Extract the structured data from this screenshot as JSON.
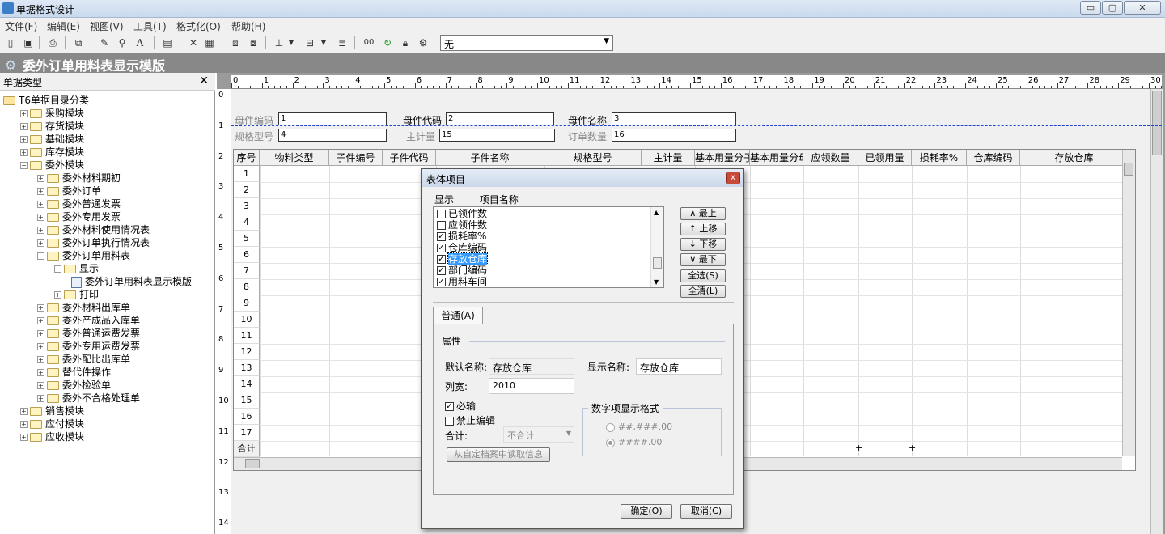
{
  "app": {
    "title": "单据格式设计",
    "win_min": "▭",
    "win_max": "▢",
    "win_close": "✕"
  },
  "menu": [
    "文件(F)",
    "编辑(E)",
    "视图(V)",
    "工具(T)",
    "格式化(O)",
    "帮助(H)"
  ],
  "toolbar": {
    "combo_value": "无",
    "text_btn": "A",
    "seq_btn": "00"
  },
  "document_title": "委外订单用料表显示模版",
  "left_panel": {
    "title": "单据类型",
    "close": "✕",
    "tree": [
      {
        "label": "T6单据目录分类",
        "level": 0,
        "pm": "",
        "root": true
      },
      {
        "label": "采购模块",
        "level": 1,
        "pm": "+"
      },
      {
        "label": "存货模块",
        "level": 1,
        "pm": "+"
      },
      {
        "label": "基础模块",
        "level": 1,
        "pm": "+"
      },
      {
        "label": "库存模块",
        "level": 1,
        "pm": "+"
      },
      {
        "label": "委外模块",
        "level": 1,
        "pm": "−"
      },
      {
        "label": "委外材料期初",
        "level": 2,
        "pm": "+"
      },
      {
        "label": "委外订单",
        "level": 2,
        "pm": "+"
      },
      {
        "label": "委外普通发票",
        "level": 2,
        "pm": "+"
      },
      {
        "label": "委外专用发票",
        "level": 2,
        "pm": "+"
      },
      {
        "label": "委外材料使用情况表",
        "level": 2,
        "pm": "+"
      },
      {
        "label": "委外订单执行情况表",
        "level": 2,
        "pm": "+"
      },
      {
        "label": "委外订单用料表",
        "level": 2,
        "pm": "−"
      },
      {
        "label": "显示",
        "level": 3,
        "pm": "−"
      },
      {
        "label": "委外订单用料表显示模版",
        "level": 4,
        "pm": "",
        "doc": true
      },
      {
        "label": "打印",
        "level": 3,
        "pm": "+"
      },
      {
        "label": "委外材料出库单",
        "level": 2,
        "pm": "+"
      },
      {
        "label": "委外产成品入库单",
        "level": 2,
        "pm": "+"
      },
      {
        "label": "委外普通运费发票",
        "level": 2,
        "pm": "+"
      },
      {
        "label": "委外专用运费发票",
        "level": 2,
        "pm": "+"
      },
      {
        "label": "委外配比出库单",
        "level": 2,
        "pm": "+"
      },
      {
        "label": "替代件操作",
        "level": 2,
        "pm": "+"
      },
      {
        "label": "委外检验单",
        "level": 2,
        "pm": "+"
      },
      {
        "label": "委外不合格处理单",
        "level": 2,
        "pm": "+"
      },
      {
        "label": "销售模块",
        "level": 1,
        "pm": "+"
      },
      {
        "label": "应付模块",
        "level": 1,
        "pm": "+"
      },
      {
        "label": "应收模块",
        "level": 1,
        "pm": "+"
      }
    ]
  },
  "ruler": {
    "h_ticks": [
      "0",
      "1",
      "2",
      "3",
      "4",
      "5",
      "6",
      "7",
      "8",
      "9",
      "10",
      "11",
      "12",
      "13",
      "14",
      "15",
      "16",
      "17",
      "18",
      "19",
      "20",
      "21",
      "22",
      "23",
      "24",
      "25",
      "26",
      "27",
      "28",
      "29",
      "30"
    ],
    "v_ticks": [
      "0",
      "1",
      "2",
      "3",
      "4",
      "5",
      "6",
      "7",
      "8",
      "9",
      "10",
      "11",
      "12",
      "13",
      "14"
    ]
  },
  "header_fields": [
    {
      "label": "母件编码",
      "value": "1",
      "bold": false
    },
    {
      "label": "母件代码",
      "value": "2",
      "bold": true
    },
    {
      "label": "母件名称",
      "value": "3",
      "bold": true
    },
    {
      "label": "规格型号",
      "value": "4",
      "bold": false
    },
    {
      "label": "主计量",
      "value": "15",
      "bold": false
    },
    {
      "label": "订单数量",
      "value": "16",
      "bold": false
    }
  ],
  "grid": {
    "columns": [
      "序号",
      "物料类型",
      "子件编号",
      "子件代码",
      "子件名称",
      "规格型号",
      "主计量",
      "基本用量分子",
      "基本用量分母",
      "应领数量",
      "已领用量",
      "损耗率%",
      "仓库编码",
      "存放仓库"
    ],
    "rows": [
      "1",
      "2",
      "3",
      "4",
      "5",
      "6",
      "7",
      "8",
      "9",
      "10",
      "11",
      "12",
      "13",
      "14",
      "15",
      "16",
      "17"
    ],
    "footer_label": "合计",
    "footer_marks": [
      "+",
      "+"
    ]
  },
  "dialog": {
    "title": "表体项目",
    "close": "x",
    "col_show": "显示",
    "col_name": "项目名称",
    "items": [
      {
        "label": "已领件数",
        "checked": false
      },
      {
        "label": "应领件数",
        "checked": false
      },
      {
        "label": "损耗率%",
        "checked": true
      },
      {
        "label": "仓库编码",
        "checked": true
      },
      {
        "label": "存放仓库",
        "checked": true,
        "selected": true
      },
      {
        "label": "部门编码",
        "checked": true
      },
      {
        "label": "用料车间",
        "checked": true
      }
    ],
    "buttons": {
      "top": "∧ 最上",
      "up": "↑ 上移",
      "down": "↓ 下移",
      "bottom": "∨ 最下",
      "select_all": "全选(S)",
      "clear_all": "全清(L)"
    },
    "tab": "普通(A)",
    "props": {
      "section": "属性",
      "default_name_label": "默认名称:",
      "default_name_value": "存放仓库",
      "display_name_label": "显示名称:",
      "display_name_value": "存放仓库",
      "width_label": "列宽:",
      "width_value": "2010",
      "required_label": "必输",
      "required_checked": true,
      "no_edit_label": "禁止编辑",
      "no_edit_checked": false,
      "sum_label": "合计:",
      "sum_value": "不合计",
      "read_btn": "从自定档案中读取信息",
      "fmt_legend": "数字项显示格式",
      "fmt_opt1": "##,###.00",
      "fmt_opt2": "####.00"
    },
    "ok": "确定(O)",
    "cancel": "取消(C)"
  }
}
